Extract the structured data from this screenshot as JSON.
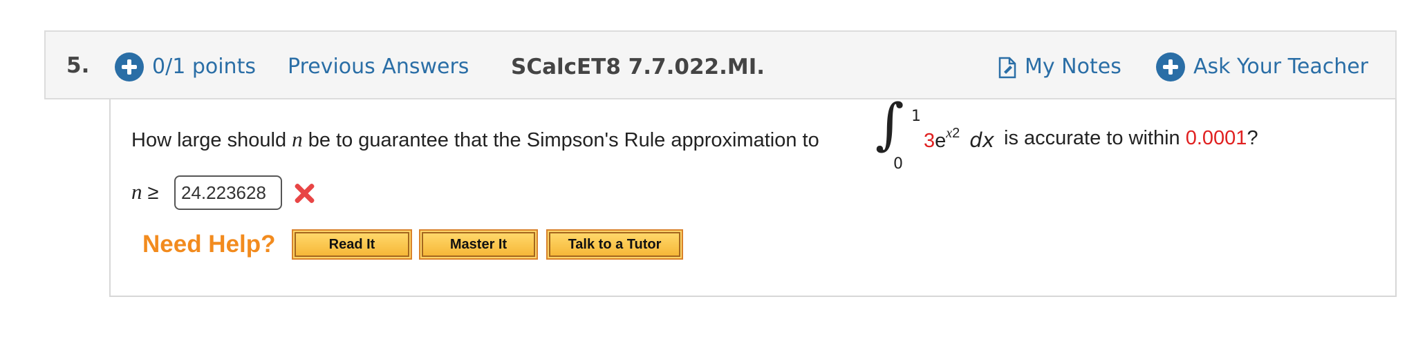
{
  "question": {
    "number": "5.",
    "points": "0/1 points",
    "previous_answers": "Previous Answers",
    "code": "SCalcET8 7.7.022.MI.",
    "my_notes": "My Notes",
    "ask_teacher": "Ask Your Teacher",
    "text_before_n": "How large should ",
    "n_var": "n",
    "text_after_n": " be to guarantee that the Simpson's Rule approximation to",
    "integral": {
      "upper": "1",
      "lower": "0",
      "coefficient": "3",
      "base": "e",
      "exponent": "x",
      "exponent_power": "2",
      "differential": "dx"
    },
    "text_tail": " is accurate to within ",
    "tolerance": "0.0001",
    "question_mark": "?"
  },
  "answer": {
    "n_var": "n",
    "relation": " ≥",
    "value": "24.223628",
    "status": "incorrect"
  },
  "help": {
    "label": "Need Help?",
    "buttons": [
      "Read It",
      "Master It",
      "Talk to a Tutor"
    ]
  },
  "colors": {
    "link": "#2a6ea6",
    "highlight": "#e02020",
    "help_label": "#f28b1e",
    "button_fill": "#fbd468"
  },
  "icons": {
    "points": "circle-plus-icon",
    "notes": "note-icon",
    "ask": "circle-plus-icon",
    "status": "red-x-icon"
  }
}
